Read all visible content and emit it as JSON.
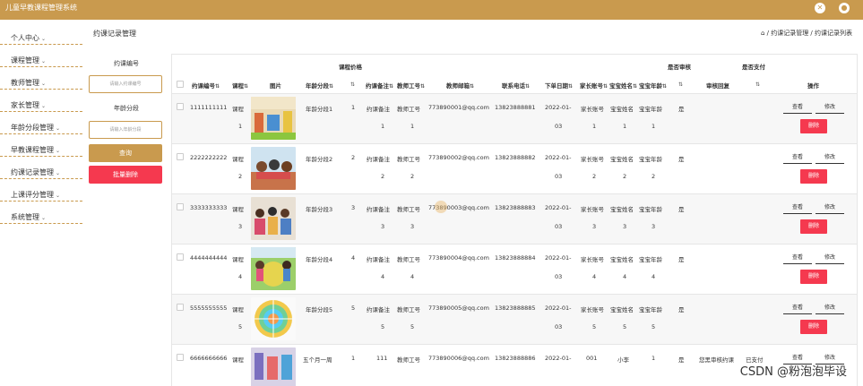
{
  "app": {
    "title": "儿童早教课程管理系统"
  },
  "topbar_icons": [
    "expand-icon",
    "user-icon"
  ],
  "sidebar": {
    "items": [
      {
        "label": "个人中心"
      },
      {
        "label": "课程管理"
      },
      {
        "label": "教师管理"
      },
      {
        "label": "家长管理"
      },
      {
        "label": "年龄分段管理"
      },
      {
        "label": "早教课程管理"
      },
      {
        "label": "约课记录管理"
      },
      {
        "label": "上课评分管理"
      },
      {
        "label": "系统管理"
      }
    ],
    "chevron": "⌄"
  },
  "page": {
    "title": "约课记录管理",
    "breadcrumb": "⌂ / 约课记录管理 / 约课记录列表"
  },
  "search": {
    "field1_label": "约课编号",
    "field1_placeholder": "请输入约课编号",
    "field2_label": "年龄分段",
    "field2_placeholder": "请输入年龄分段",
    "query_button": "查询",
    "batch_delete_button": "批量删除"
  },
  "table": {
    "group_headers": {
      "price": "课程价格",
      "audit": "是否审核",
      "paid": "是否支付"
    },
    "headers": {
      "id": "约课编号",
      "course": "课程",
      "image": "图片",
      "age": "年龄分段",
      "remark": "约课备注",
      "teacher_no": "教师工号",
      "teacher_email": "教师邮箱",
      "phone": "联系电话",
      "date": "下单日期",
      "parent": "家长账号",
      "baby_name": "宝宝姓名",
      "baby_age": "宝宝年龄",
      "reply": "审核回复",
      "actions": "操作"
    },
    "sort_icon": "⇅",
    "rows": [
      {
        "id": "1111111111",
        "course": "课程",
        "course_no": "1",
        "age": "年龄分段1",
        "price": "1",
        "remark": "约课备注",
        "remark_no": "1",
        "teacher_no": "教师工号",
        "teacher_no2": "1",
        "email": "773890001@qq.com",
        "phone": "13823888881",
        "date": "2022-01-",
        "date2": "03",
        "parent": "家长账号",
        "parent_no": "1",
        "baby": "宝宝姓名",
        "baby_no": "1",
        "baby_age": "宝宝年龄",
        "baby_age_no": "1",
        "audit": "是",
        "reply": "",
        "paid": ""
      },
      {
        "id": "2222222222",
        "course": "课程",
        "course_no": "2",
        "age": "年龄分段2",
        "price": "2",
        "remark": "约课备注",
        "remark_no": "2",
        "teacher_no": "教师工号",
        "teacher_no2": "2",
        "email": "773890002@qq.com",
        "phone": "13823888882",
        "date": "2022-01-",
        "date2": "03",
        "parent": "家长账号",
        "parent_no": "2",
        "baby": "宝宝姓名",
        "baby_no": "2",
        "baby_age": "宝宝年龄",
        "baby_age_no": "2",
        "audit": "是",
        "reply": "",
        "paid": ""
      },
      {
        "id": "3333333333",
        "course": "课程",
        "course_no": "3",
        "age": "年龄分段3",
        "price": "3",
        "remark": "约课备注",
        "remark_no": "3",
        "teacher_no": "教师工号",
        "teacher_no2": "3",
        "email": "773890003@qq.com",
        "phone": "13823888883",
        "date": "2022-01-",
        "date2": "03",
        "parent": "家长账号",
        "parent_no": "3",
        "baby": "宝宝姓名",
        "baby_no": "3",
        "baby_age": "宝宝年龄",
        "baby_age_no": "3",
        "audit": "是",
        "reply": "",
        "paid": ""
      },
      {
        "id": "4444444444",
        "course": "课程",
        "course_no": "4",
        "age": "年龄分段4",
        "price": "4",
        "remark": "约课备注",
        "remark_no": "4",
        "teacher_no": "教师工号",
        "teacher_no2": "4",
        "email": "773890004@qq.com",
        "phone": "13823888884",
        "date": "2022-01-",
        "date2": "03",
        "parent": "家长账号",
        "parent_no": "4",
        "baby": "宝宝姓名",
        "baby_no": "4",
        "baby_age": "宝宝年龄",
        "baby_age_no": "4",
        "audit": "是",
        "reply": "",
        "paid": ""
      },
      {
        "id": "5555555555",
        "course": "课程",
        "course_no": "5",
        "age": "年龄分段5",
        "price": "5",
        "remark": "约课备注",
        "remark_no": "5",
        "teacher_no": "教师工号",
        "teacher_no2": "5",
        "email": "773890005@qq.com",
        "phone": "13823888885",
        "date": "2022-01-",
        "date2": "03",
        "parent": "家长账号",
        "parent_no": "5",
        "baby": "宝宝姓名",
        "baby_no": "5",
        "baby_age": "宝宝年龄",
        "baby_age_no": "5",
        "audit": "是",
        "reply": "",
        "paid": ""
      },
      {
        "id": "6666666666",
        "course": "课程",
        "course_no": "",
        "age": "五个月一周",
        "price": "1",
        "remark": "111",
        "remark_no": "",
        "teacher_no": "教师工号",
        "teacher_no2": "",
        "email": "773890006@qq.com",
        "phone": "13823888886",
        "date": "2022-01-",
        "date2": "",
        "parent": "001",
        "parent_no": "",
        "baby": "小李",
        "baby_no": "",
        "baby_age": "1",
        "baby_age_no": "",
        "audit": "是",
        "reply": "您黑审核约课",
        "paid": "已支付"
      }
    ],
    "view_label": "查看",
    "edit_label": "修改",
    "delete_label": "删除"
  },
  "watermark": "CSDN @粉泡泡毕设",
  "colors": {
    "brand": "#c99a4e",
    "danger": "#f5394f"
  }
}
